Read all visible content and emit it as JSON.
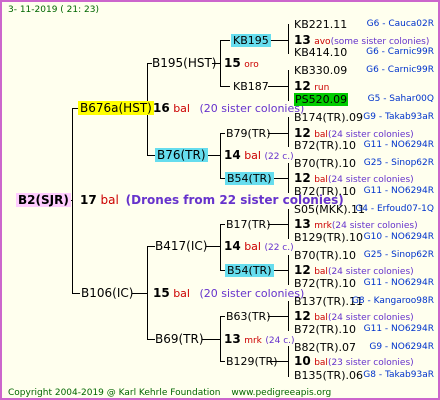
{
  "header_date": "3-  11-2019  ( 21:  23)",
  "footer": {
    "copyright": "Copyright 2004-2019 @ Karl Kehrle Foundation",
    "url": "www.pedigreeapis.org"
  },
  "root": {
    "name": "B2(SJR)",
    "count": "17",
    "bal": "bal",
    "drones": "(Drones from 22 sister colonies)"
  },
  "gen1": {
    "top": {
      "name": "B676a(HST)",
      "count": "16",
      "bal": "bal",
      "note": "(20 sister colonies)"
    },
    "bottom": {
      "name": "B106(IC)",
      "count": "15",
      "bal": "bal",
      "note": "(20 sister colonies)"
    }
  },
  "gen2": {
    "b195": {
      "name": "B195(HST)",
      "count": "15",
      "type": "oro"
    },
    "b76": {
      "name": "B76(TR)",
      "count": "14",
      "type": "bal",
      "note": "(22 c.)"
    },
    "b417": {
      "name": "B417(IC)",
      "count": "14",
      "type": "bal",
      "note": "(22 c.)"
    },
    "b69": {
      "name": "B69(TR)",
      "count": "13",
      "type": "mrk",
      "note": "(24 c.)"
    }
  },
  "gen3": {
    "kb195": {
      "name": "KB195"
    },
    "kb187": {
      "name": "KB187"
    },
    "b79": {
      "name": "B79(TR)",
      "count": "12",
      "type": "bal",
      "note": "(24 sister colonies)"
    },
    "b54a": {
      "name": "B54(TR)",
      "count": "12",
      "type": "bal",
      "note": "(24 sister colonies)"
    },
    "b17": {
      "name": "B17(TR)",
      "count": "13",
      "type": "mrk",
      "note": "(24 sister colonies)"
    },
    "b54b": {
      "name": "B54(TR)",
      "count": "12",
      "type": "bal",
      "note": "(24 sister colonies)"
    },
    "b63": {
      "name": "B63(TR)",
      "count": "12",
      "type": "bal",
      "note": "(24 sister colonies)"
    },
    "b129": {
      "name": "B129(TR)",
      "count": "10",
      "type": "bal",
      "note": "(23 sister colonies)"
    }
  },
  "kb195_row": {
    "count": "13",
    "type": "avo",
    "note": "(some sister colonies)"
  },
  "kb187_row": {
    "count": "12",
    "type": "run"
  },
  "gen4": [
    {
      "name": "KB221.11",
      "code": "G6 - Cauca02R"
    },
    {
      "name": "KB414.10",
      "code": "G6 - Carnic99R"
    },
    {
      "name": "KB330.09",
      "code": "G6 - Carnic99R"
    },
    {
      "name": "PS520.09",
      "code": "G5 - Sahar00Q"
    },
    {
      "name": "B174(TR).09",
      "code": "G9 - Takab93aR"
    },
    {
      "name": "B72(TR).10",
      "code": "G11 - NO6294R"
    },
    {
      "name": "B70(TR).10",
      "code": "G25 - Sinop62R"
    },
    {
      "name": "B72(TR).10",
      "code": "G11 - NO6294R"
    },
    {
      "name": "S05(MKK).11",
      "code": "G4 - Erfoud07-1Q"
    },
    {
      "name": "B129(TR).10",
      "code": "G10 - NO6294R"
    },
    {
      "name": "B70(TR).10",
      "code": "G25 - Sinop62R"
    },
    {
      "name": "B72(TR).10",
      "code": "G11 - NO6294R"
    },
    {
      "name": "B137(TR).11",
      "code": "G8 - Kangaroo98R"
    },
    {
      "name": "B72(TR).10",
      "code": "G11 - NO6294R"
    },
    {
      "name": "B82(TR).07",
      "code": "G9 - NO6294R"
    },
    {
      "name": "B135(TR).06",
      "code": "G8 - Takab93aR"
    }
  ]
}
